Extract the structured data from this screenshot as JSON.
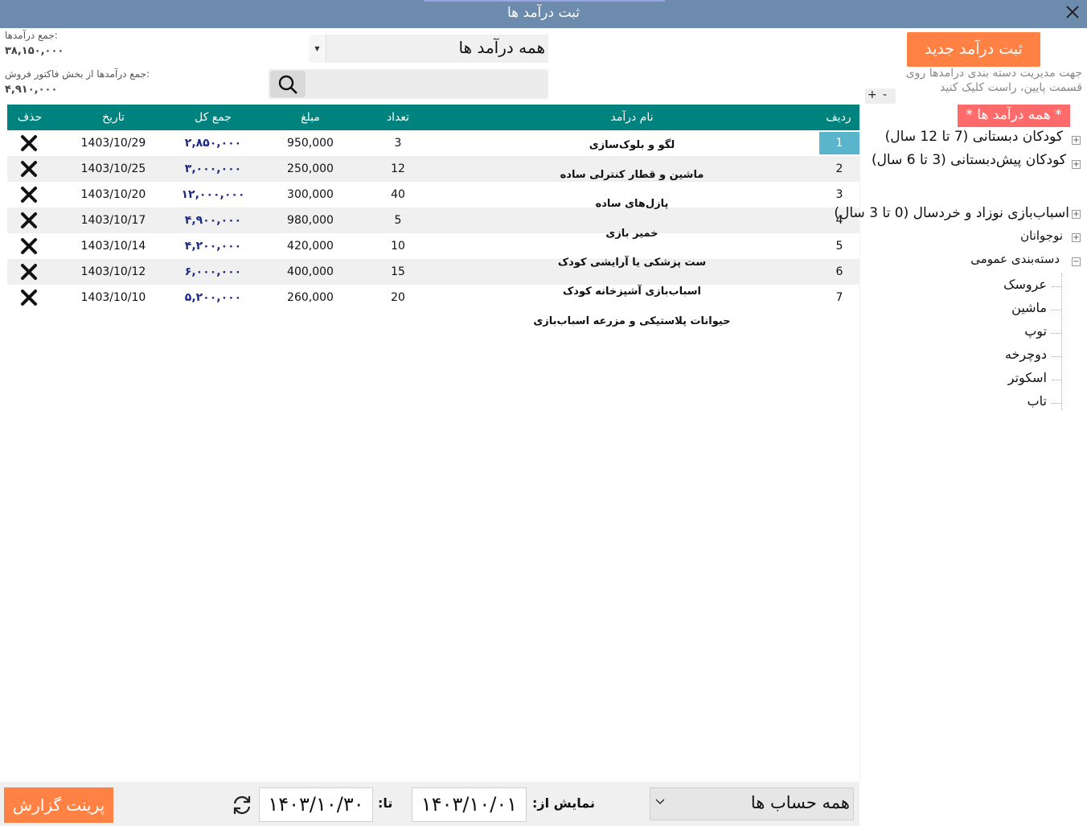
{
  "window": {
    "title": "ثبت درآمد ها",
    "close_icon": "close-icon"
  },
  "totals": {
    "income_label": "جمع درآمدها:",
    "income_value": "۳۸,۱۵۰,۰۰۰",
    "sales_label": "جمع درآمدها از بخش فاکتور فروش:",
    "sales_value": "۴,۹۱۰,۰۰۰"
  },
  "filter": {
    "category_value": "همه درآمد ها"
  },
  "toolbar": {
    "new_income_label": "ثبت درآمد جدید",
    "hint": "جهت مدیریت دسته بندی درامدها روی قسمت پایین، راست کلیک کنید",
    "plus": "+",
    "minus": "-"
  },
  "table": {
    "headers": {
      "row": "ردیف",
      "name": "نام درآمد",
      "count": "تعداد",
      "amount": "مبلغ",
      "total": "جمع کل",
      "date": "تاریخ",
      "delete": "حذف"
    },
    "rows": [
      {
        "row": "1",
        "count": "3",
        "amount": "950,000",
        "total": "۲,۸۵۰,۰۰۰",
        "date": "1403/10/29"
      },
      {
        "row": "2",
        "count": "12",
        "amount": "250,000",
        "total": "۳,۰۰۰,۰۰۰",
        "date": "1403/10/25"
      },
      {
        "row": "3",
        "count": "40",
        "amount": "300,000",
        "total": "۱۲,۰۰۰,۰۰۰",
        "date": "1403/10/20"
      },
      {
        "row": "4",
        "count": "5",
        "amount": "980,000",
        "total": "۴,۹۰۰,۰۰۰",
        "date": "1403/10/17"
      },
      {
        "row": "5",
        "count": "10",
        "amount": "420,000",
        "total": "۴,۲۰۰,۰۰۰",
        "date": "1403/10/14"
      },
      {
        "row": "6",
        "count": "15",
        "amount": "400,000",
        "total": "۶,۰۰۰,۰۰۰",
        "date": "1403/10/12"
      },
      {
        "row": "7",
        "count": "20",
        "amount": "260,000",
        "total": "۵,۲۰۰,۰۰۰",
        "date": "1403/10/10"
      }
    ],
    "names": [
      "لگو و بلوک‌سازی",
      "ماشین و قطار کنترلی ساده",
      "پازل‌های ساده",
      "خمیر بازی",
      "ست پزشکی یا آرایشی کودک",
      "اسباب‌بازی آشپزخانه کودک",
      "حیوانات پلاستیکی و مزرعه اسباب‌بازی"
    ]
  },
  "tree": {
    "root": "* همه درآمد ها *",
    "nodes": [
      "کودکان دبستانی (7 تا 12 سال)",
      "کودکان پیش‌دبستانی (3 تا 6 سال)",
      "اسباب‌بازی نوزاد و خردسال (0 تا 3 سال)",
      "نوجوانان",
      "دسته‌بندی عمومی"
    ],
    "children": [
      "عروسک",
      "ماشین",
      "توپ",
      "دوچرخه",
      "اسکوتر",
      "تاب"
    ]
  },
  "footer": {
    "print_label": "پرینت گزارش",
    "to_label": "تا:",
    "to_date": "۱۴۰۳/۱۰/۳۰",
    "from_label": "نمایش از:",
    "from_date": "۱۴۰۳/۱۰/۰۱",
    "accounts_value": "همه حساب ها"
  },
  "colors": {
    "accent": "#ff8244",
    "header": "#00827e",
    "titlebar": "#6d8cad",
    "tree_root": "#ff6b6b",
    "selected_row": "#5ab4cc"
  }
}
